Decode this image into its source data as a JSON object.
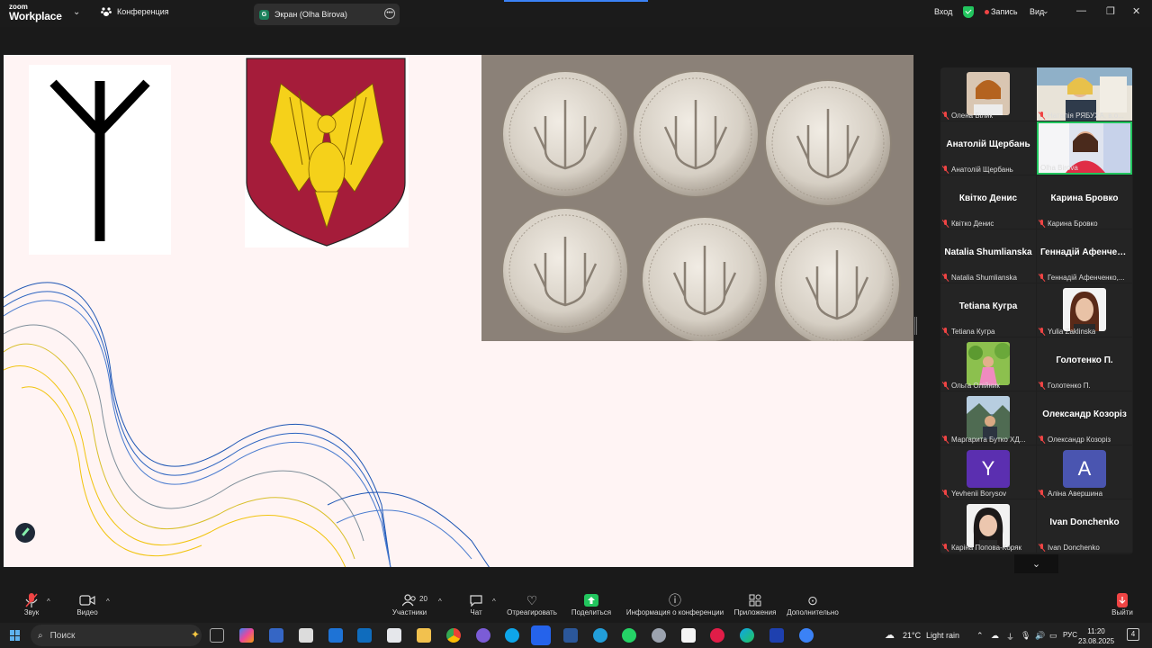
{
  "app": {
    "brand_top": "zoom",
    "brand_bottom": "Workplace",
    "meeting_tab": "Конференция",
    "share_tab": "Экран (Olha Birova)",
    "share_tab_badge": "G",
    "signin": "Вход",
    "recording": "Запись",
    "view": "Вид"
  },
  "gallery": [
    {
      "display": "photo",
      "caption": "Олена Білик"
    },
    {
      "display": "photo",
      "caption": "Наталія РЯБУХА, в.о..."
    },
    {
      "display": "name",
      "name": "Анатолій Щербань",
      "caption": "Анатолій Щербань"
    },
    {
      "display": "photo",
      "caption": "Olha Birova",
      "active_speaker": true
    },
    {
      "display": "name",
      "name": "Квітко Денис",
      "caption": "Квітко Денис"
    },
    {
      "display": "name",
      "name": "Карина Бровко",
      "caption": "Карина Бровко"
    },
    {
      "display": "name",
      "name": "Natalia Shumlianska",
      "caption": "Natalia Shumlianska"
    },
    {
      "display": "name",
      "name": "Геннадій Афенченко",
      "caption": "Геннадій Афенченко,..."
    },
    {
      "display": "name",
      "name": "Tetiana Кугра",
      "caption": "Tetiana Кугра"
    },
    {
      "display": "photo",
      "caption": "Yulia Zaklinska"
    },
    {
      "display": "photo",
      "caption": "Ольга Олійник"
    },
    {
      "display": "name",
      "name": "Голотенко П.",
      "caption": "Голотенко П."
    },
    {
      "display": "photo",
      "caption": "Маргарита Бутко ХД..."
    },
    {
      "display": "name",
      "name": "Олександр Козоріз",
      "caption": "Олександр Козоріз"
    },
    {
      "display": "initial",
      "initial": "Y",
      "color": "#5b2fb0",
      "caption": "Yevhenii Borysov"
    },
    {
      "display": "initial",
      "initial": "A",
      "color": "#4a55b0",
      "caption": "Аліна Авершина"
    },
    {
      "display": "photo",
      "caption": "Каріна Попова-Коряк"
    },
    {
      "display": "name",
      "name": "Ivan Donchenko",
      "caption": "Ivan Donchenko"
    }
  ],
  "toolbar": {
    "audio": "Звук",
    "video": "Видео",
    "participants": "Участники",
    "participants_count": "20",
    "chat": "Чат",
    "react": "Отреагировать",
    "share": "Поделиться",
    "info": "Информация о конференции",
    "apps": "Приложения",
    "more": "Дополнительно",
    "leave": "Выйти"
  },
  "taskbar": {
    "search": "Поиск",
    "weather_temp": "21°C",
    "weather_desc": "Light rain",
    "lang": "РУС",
    "time": "11:20",
    "date": "23.08.2025",
    "notifications": "4"
  },
  "colors": {
    "accent": "#0b5cff",
    "active_speaker": "#22c55e",
    "record": "#ef4444",
    "flag_blue": "#1e56b4",
    "flag_yellow": "#f1c40f"
  }
}
